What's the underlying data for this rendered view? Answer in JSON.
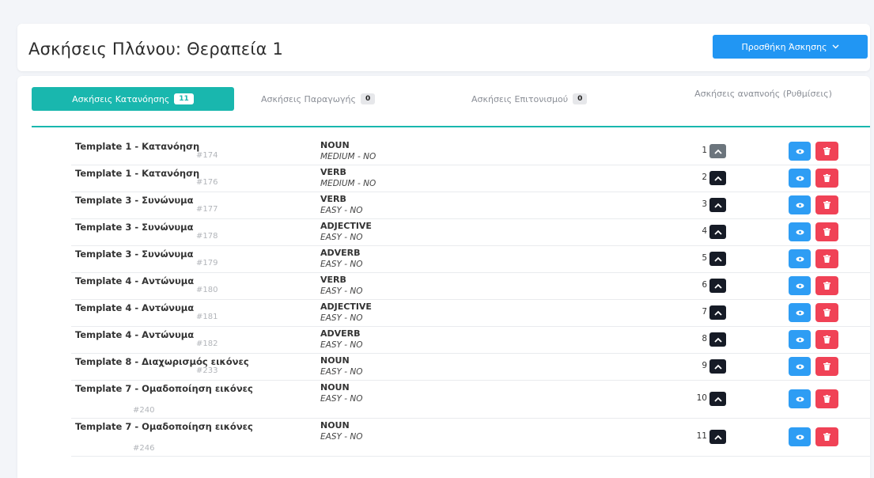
{
  "header": {
    "title": "Ασκήσεις Πλάνου: Θεραπεία 1",
    "add_button_label": "Προσθήκη Άσκησης",
    "add_button_icon": "chevron-down-icon"
  },
  "tabs": [
    {
      "label": "Ασκήσεις Κατανόησης",
      "count": "11",
      "active": true
    },
    {
      "label": "Ασκήσεις Παραγωγής",
      "count": "0",
      "active": false
    },
    {
      "label": "Ασκήσεις Επιτονισμού",
      "count": "0",
      "active": false
    },
    {
      "label": "Ασκήσεις αναπνοής (Ρυθμίσεις)",
      "count": "",
      "active": false
    }
  ],
  "colors": {
    "accent": "#19b7ae",
    "primary": "#2196f3",
    "view": "#2e9df4",
    "danger": "#f04256",
    "dark": "#161b26",
    "muted": "#6c757d"
  },
  "rows": [
    {
      "name": "Template 1 - Κατανόηση",
      "id": "#174",
      "type": "NOUN",
      "level": "MEDIUM - NO",
      "position": "1"
    },
    {
      "name": "Template 1 - Κατανόηση",
      "id": "#176",
      "type": "VERB",
      "level": "MEDIUM - NO",
      "position": "2"
    },
    {
      "name": "Template 3 - Συνώνυμα",
      "id": "#177",
      "type": "VERB",
      "level": "EASY - NO",
      "position": "3"
    },
    {
      "name": "Template 3 - Συνώνυμα",
      "id": "#178",
      "type": "ADJECTIVE",
      "level": "EASY - NO",
      "position": "4"
    },
    {
      "name": "Template 3 - Συνώνυμα",
      "id": "#179",
      "type": "ADVERB",
      "level": "EASY - NO",
      "position": "5"
    },
    {
      "name": "Template 4 - Αντώνυμα",
      "id": "#180",
      "type": "VERB",
      "level": "EASY - NO",
      "position": "6"
    },
    {
      "name": "Template 4 - Αντώνυμα",
      "id": "#181",
      "type": "ADJECTIVE",
      "level": "EASY - NO",
      "position": "7"
    },
    {
      "name": "Template 4 - Αντώνυμα",
      "id": "#182",
      "type": "ADVERB",
      "level": "EASY - NO",
      "position": "8"
    },
    {
      "name": "Template 8 - Διαχωρισμός εικόνες",
      "id": "#233",
      "type": "NOUN",
      "level": "EASY - NO",
      "position": "9"
    },
    {
      "name": "Template 7 - Ομαδοποίηση εικόνες",
      "id": "#240",
      "type": "NOUN",
      "level": "EASY - NO",
      "position": "10"
    },
    {
      "name": "Template 7 - Ομαδοποίηση εικόνες",
      "id": "#246",
      "type": "NOUN",
      "level": "EASY - NO",
      "position": "11"
    }
  ],
  "row_icons": {
    "move_up": "chevron-up-icon",
    "view": "eye-icon",
    "delete": "trash-icon"
  }
}
